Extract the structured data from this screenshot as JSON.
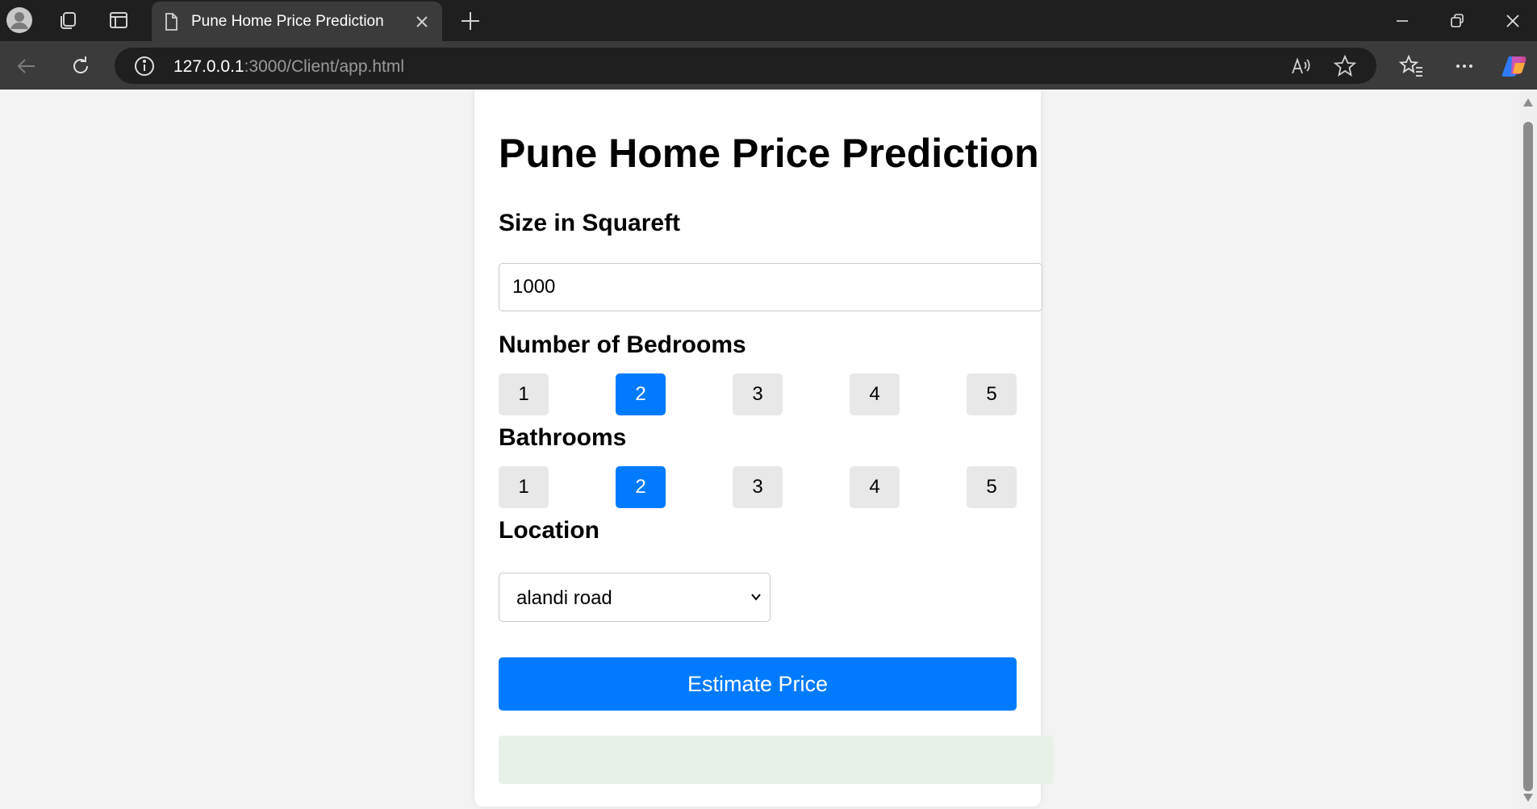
{
  "browser": {
    "tab_title": "Pune Home Price Prediction",
    "url_host": "127.0.0.1",
    "url_rest": ":3000/Client/app.html"
  },
  "page": {
    "title": "Pune Home Price Prediction",
    "size_label": "Size in Squareft",
    "size_value": "1000",
    "bedrooms_label": "Number of Bedrooms",
    "bedroom_options": [
      "1",
      "2",
      "3",
      "4",
      "5"
    ],
    "bedrooms_selected": "2",
    "bathrooms_label": "Bathrooms",
    "bathroom_options": [
      "1",
      "2",
      "3",
      "4",
      "5"
    ],
    "bathrooms_selected": "2",
    "location_label": "Location",
    "location_selected": "alandi road",
    "estimate_button": "Estimate Price",
    "result_text": ""
  },
  "colors": {
    "accent": "#007bff",
    "option_bg": "#e8e8e8",
    "result_bg": "#e7f1e7",
    "chrome_dark": "#1f1f1f",
    "chrome_tab": "#3b3b3b"
  },
  "icons": {
    "profile": "profile-icon",
    "workspaces": "workspaces-icon",
    "tab_actions": "tab-actions-icon",
    "page": "page-icon",
    "close": "close-icon",
    "new_tab": "plus-icon",
    "back": "back-arrow-icon",
    "reload": "reload-icon",
    "site_info": "info-icon",
    "read_aloud": "read-aloud-icon",
    "favorite": "star-icon",
    "favorites": "favorites-icon",
    "more": "more-icon",
    "copilot": "copilot-icon"
  }
}
